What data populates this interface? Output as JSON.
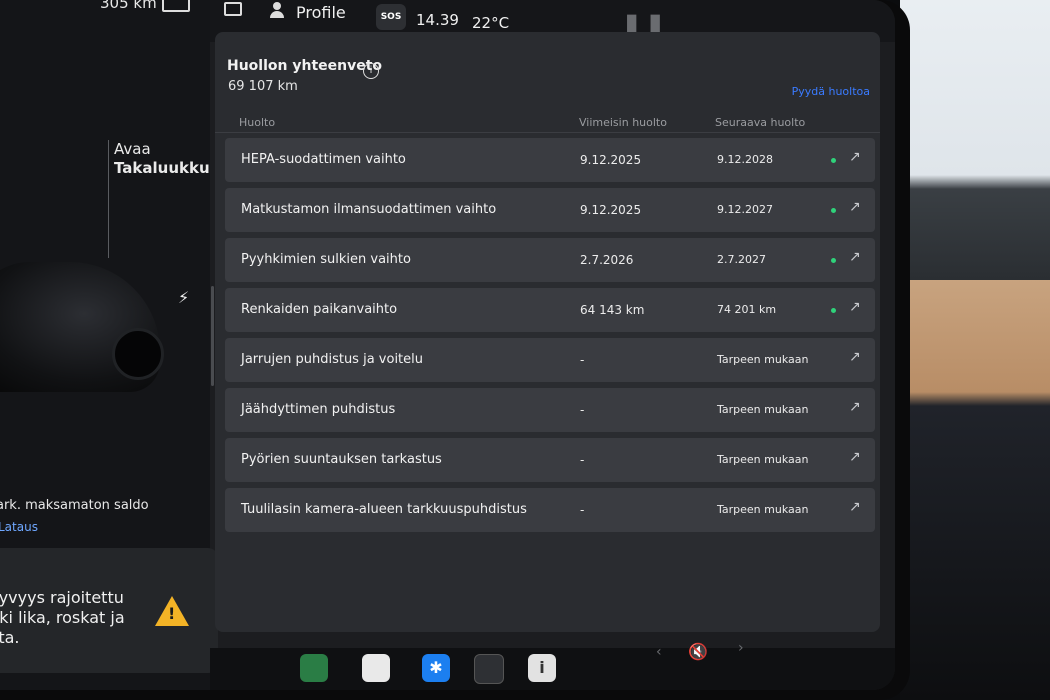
{
  "status": {
    "range": "305 km",
    "profile": "Profile",
    "sos": "SOS",
    "time": "14.39",
    "temperature": "22°C"
  },
  "left_panel": {
    "trunk_line1": "Avaa",
    "trunk_line2": "Takaluukku",
    "unpaid_balance": "ark. maksamaton saldo",
    "charging_link": "Lataus",
    "warning_text": "kyvyys rajoitettu\nkki lika, roskat ja\nsta."
  },
  "service": {
    "title": "Huollon yhteenveto",
    "odometer": "69 107  km",
    "request_link": "Pyydä huoltoa",
    "columns": {
      "service": "Huolto",
      "last": "Viimeisin huolto",
      "next": "Seuraava huolto"
    },
    "rows": [
      {
        "name": "HEPA-suodattimen vaihto",
        "last": "9.12.2025",
        "next": "9.12.2028",
        "status": "ok"
      },
      {
        "name": "Matkustamon ilmansuodattimen vaihto",
        "last": "9.12.2025",
        "next": "9.12.2027",
        "status": "ok"
      },
      {
        "name": "Pyyhkimien sulkien vaihto",
        "last": "2.7.2026",
        "next": "2.7.2027",
        "status": "ok"
      },
      {
        "name": "Renkaiden paikanvaihto",
        "last": "64 143 km",
        "next": "74 201 km",
        "status": "ok"
      },
      {
        "name": "Jarrujen puhdistus ja voitelu",
        "last": "-",
        "next": "Tarpeen mukaan",
        "status": "none"
      },
      {
        "name": "Jäähdyttimen puhdistus",
        "last": "-",
        "next": "Tarpeen mukaan",
        "status": "none"
      },
      {
        "name": "Pyörien suuntauksen tarkastus",
        "last": "-",
        "next": "Tarpeen mukaan",
        "status": "none"
      },
      {
        "name": "Tuulilasin kamera-alueen tarkkuuspuhdistus",
        "last": "-",
        "next": "Tarpeen mukaan",
        "status": "none"
      }
    ],
    "status_color": "#2fd27a",
    "link_color": "#3a7bff"
  },
  "dock": {
    "icons": [
      "unknown-icon",
      "chart-icon",
      "notepad-icon",
      "bluetooth-icon",
      "apps-icon",
      "info-icon"
    ],
    "mute": "mute-icon"
  }
}
